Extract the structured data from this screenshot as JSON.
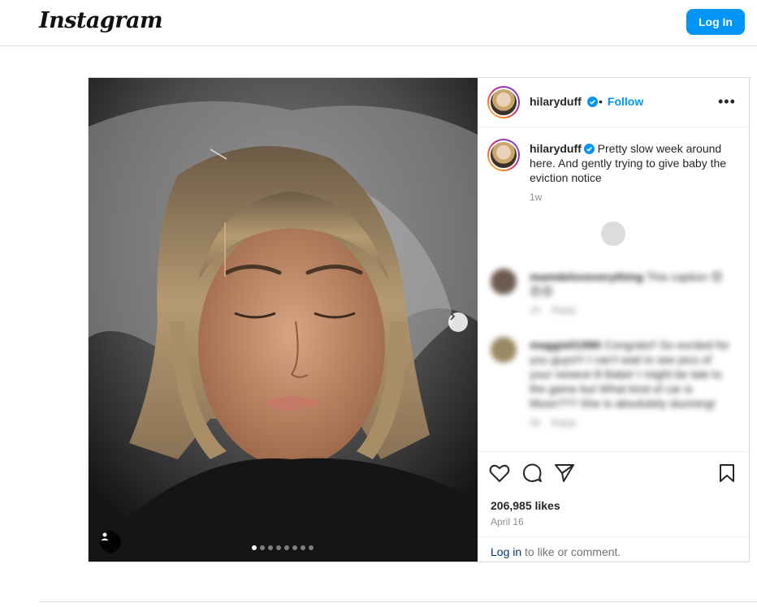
{
  "header": {
    "logo": "Instagram",
    "login_label": "Log In"
  },
  "post": {
    "username": "hilaryduff",
    "follow_label": "Follow",
    "separator": "•",
    "more_label": "•••",
    "caption": "Pretty slow week around here. And gently trying to give baby the eviction notice",
    "caption_time": "1w",
    "comments": [
      {
        "username": "mamdeloveverything",
        "text": "This caption 😍😍😍",
        "time": "1h",
        "reply": "Reply"
      },
      {
        "username": "maggieli1990",
        "text": "Congrats!! So excited for you guys!!! I can't wait to see pics of your newest lil Babe! I might be late to the game but What kind of car is Moon??? She is absolutely stunning!",
        "time": "3h",
        "reply": "Reply"
      }
    ],
    "likes": "206,985 likes",
    "date": "April 16",
    "login_link": "Log in",
    "login_rest": " to like or comment.",
    "carousel": {
      "total": 8,
      "active": 0
    }
  },
  "colors": {
    "accent": "#0095f6",
    "border": "#dbdbdb",
    "muted": "#8e8e8e"
  }
}
